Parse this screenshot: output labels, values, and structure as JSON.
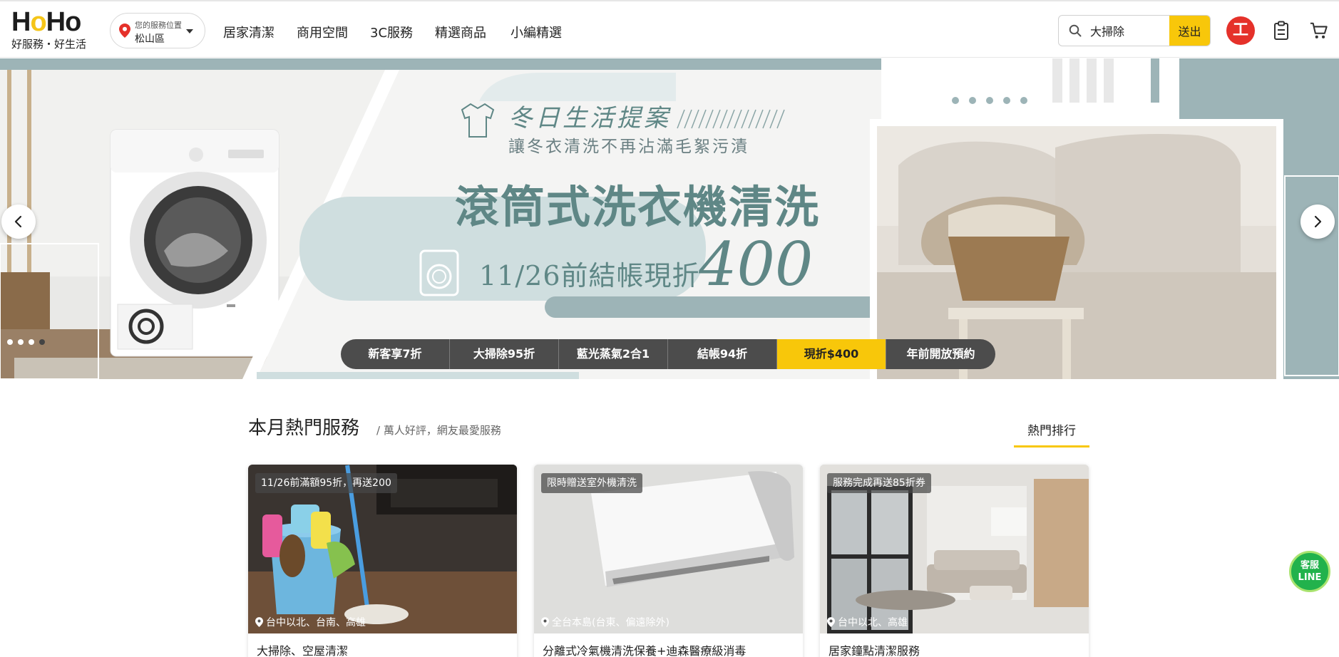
{
  "header": {
    "logo_text": "HoHo",
    "logo_tagline": "好服務・好生活",
    "location": {
      "caption": "您的服務位置",
      "value": "松山區"
    },
    "nav": [
      "居家清潔",
      "商用空間",
      "3C服務",
      "精選商品",
      "小編精選"
    ],
    "search": {
      "value": "大掃除",
      "button": "送出"
    },
    "avatar_initial": "工",
    "icons": {
      "search": "search-icon",
      "clipboard": "clipboard-icon",
      "cart": "cart-icon",
      "location": "map-pin-icon"
    }
  },
  "hero": {
    "script_title": "冬日生活提案",
    "subtitle": "讓冬衣清洗不再沾滿毛絮污漬",
    "title": "滾筒式洗衣機清洗",
    "promo_text": "11/26前結帳現折",
    "promo_amount": "400",
    "tags": [
      "新客享7折",
      "大掃除95折",
      "藍光蒸氣2合1",
      "結帳94折",
      "現折$400",
      "年前開放預約"
    ],
    "active_tag_index": 4,
    "slide_count": 4,
    "active_slide_index": 3
  },
  "hot": {
    "title": "本月熱門服務",
    "subtitle": "/ 萬人好評，網友最愛服務",
    "ranking_link": "熱門排行",
    "cards": [
      {
        "badge": "11/26前滿額95折，再送200",
        "location": "台中以北、台南、高雄",
        "title": "大掃除、空屋清潔"
      },
      {
        "badge": "限時贈送室外機清洗",
        "location": "全台本島(台東、偏遠除外)",
        "title": "分離式冷氣機清洗保養+迪森醫療級消毒"
      },
      {
        "badge": "服務完成再送85折券",
        "location": "台中以北、高雄",
        "title": "居家鐘點清潔服務"
      }
    ]
  },
  "line_button": {
    "line1": "客服",
    "line2": "LINE"
  },
  "colors": {
    "accent": "#f8c70a",
    "teal": "#5f8786",
    "avatar": "#e5312a",
    "line_green": "#22b24c"
  }
}
